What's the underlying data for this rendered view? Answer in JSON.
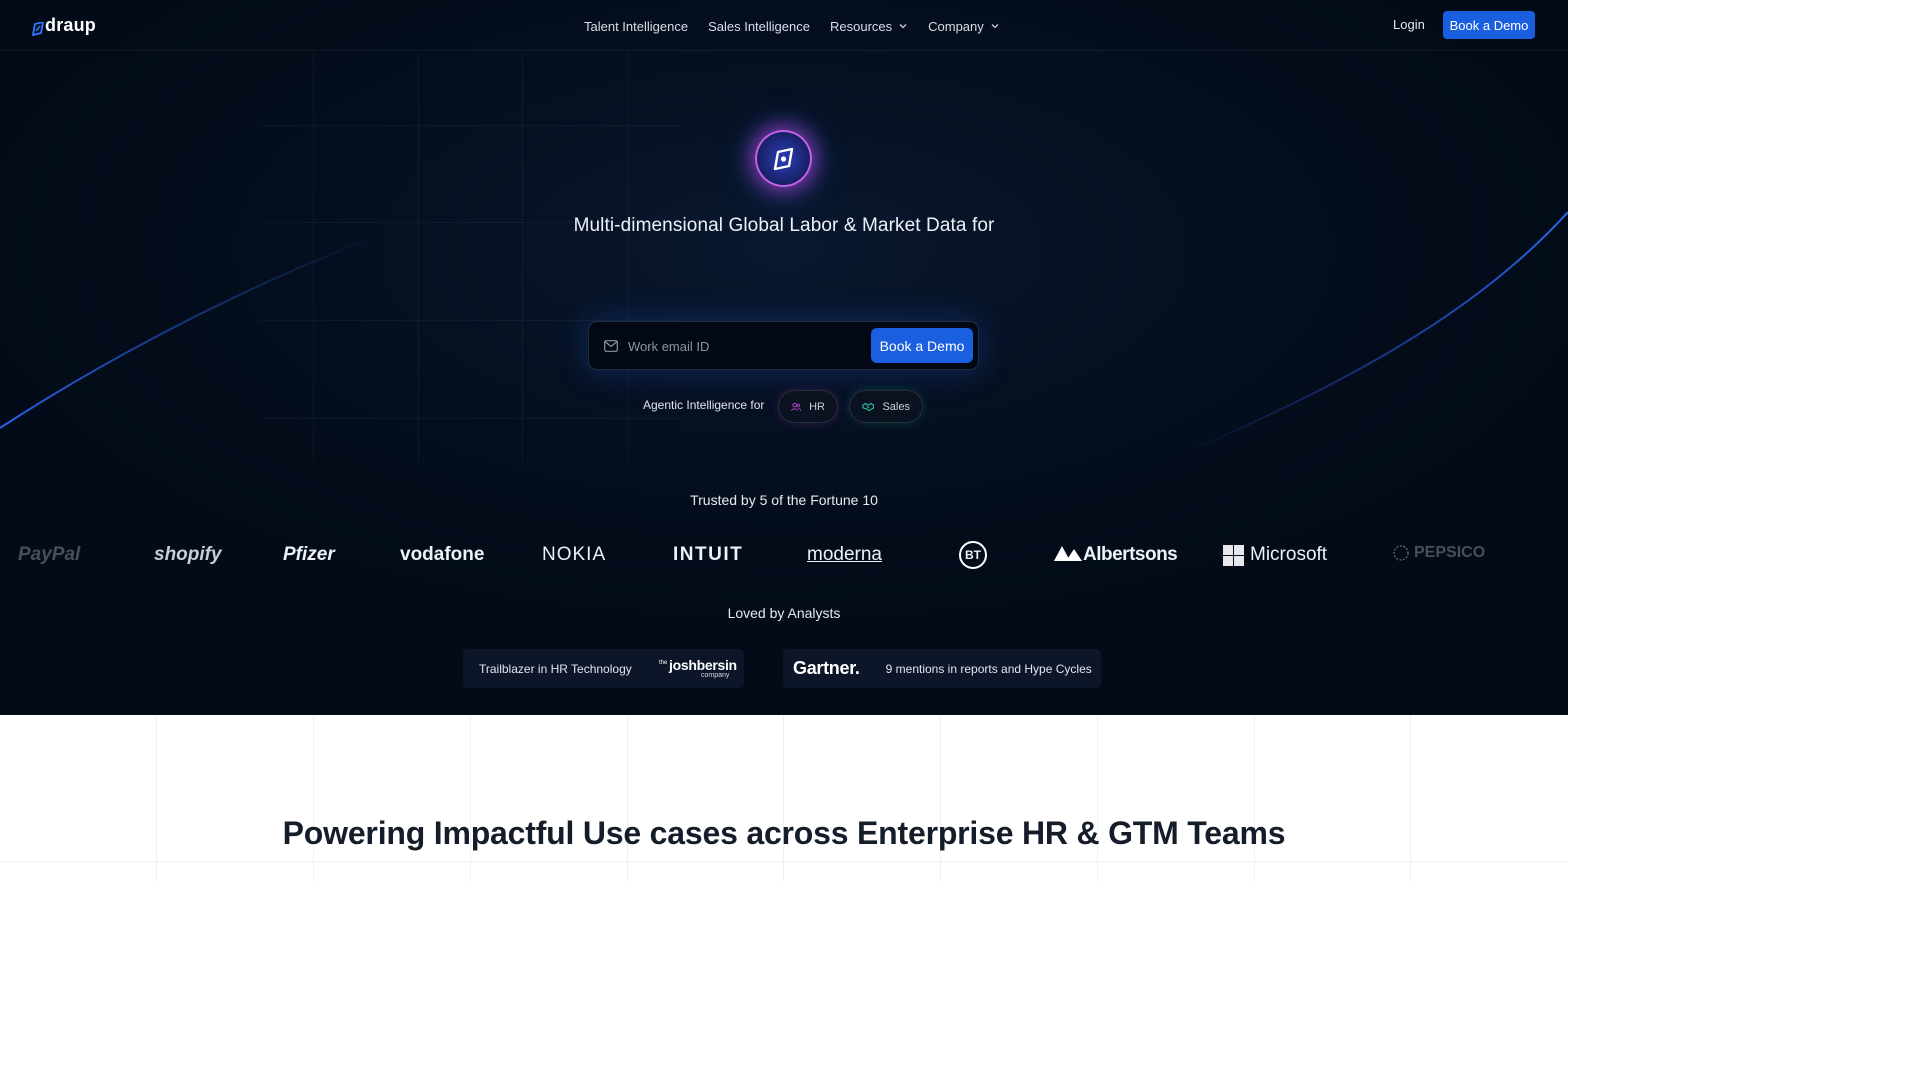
{
  "nav": {
    "logo_text": "draup",
    "links": [
      {
        "label": "Talent Intelligence",
        "has_caret": false
      },
      {
        "label": "Sales Intelligence",
        "has_caret": false
      },
      {
        "label": "Resources",
        "has_caret": true
      },
      {
        "label": "Company",
        "has_caret": true
      }
    ],
    "login_label": "Login",
    "demo_label": "Book a Demo"
  },
  "hero": {
    "headline": "Multi-dimensional Global Labor & Market Data for",
    "email_placeholder": "Work email ID",
    "demo_label": "Book a Demo",
    "agentic_label": "Agentic Intelligence for",
    "pills": [
      {
        "label": "HR",
        "icon": "users-icon",
        "color": "#c04ce0"
      },
      {
        "label": "Sales",
        "icon": "handshake-icon",
        "color": "#2ec7a8"
      }
    ]
  },
  "trusted": {
    "heading": "Trusted by 5 of the Fortune 10",
    "brands": [
      "PayPal",
      "shopify",
      "Pfizer",
      "vodafone",
      "NOKIA",
      "INTUIT",
      "moderna",
      "BT",
      "Albertsons",
      "Microsoft",
      "PEPSICO"
    ]
  },
  "analysts": {
    "heading": "Loved by Analysts",
    "badge_left_text": "Trailblazer in HR Technology",
    "josh_the": "the",
    "josh_name": "joshbersin",
    "josh_company": "company",
    "gartner_logo": "Gartner.",
    "badge_right_text": "9 mentions in reports and Hype Cycles"
  },
  "section": {
    "heading": "Powering Impactful Use cases across Enterprise HR & GTM Teams"
  },
  "colors": {
    "hero_bg": "#030b18",
    "accent": "#1a5fe0",
    "hr_pill": "#c04ce0",
    "sales_pill": "#2ec7a8"
  }
}
